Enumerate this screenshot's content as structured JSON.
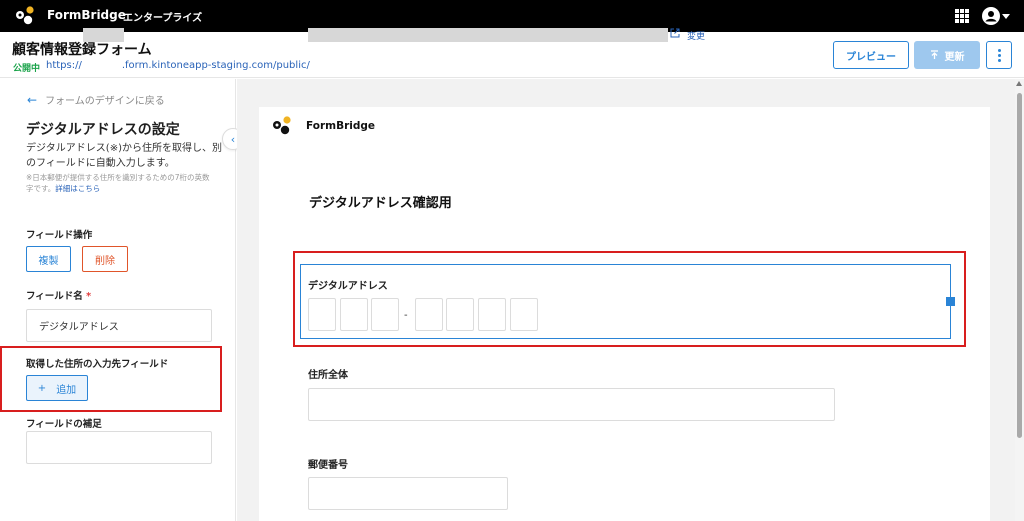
{
  "topbar": {
    "brand": "FormBridge",
    "edition": "エンタープライズ"
  },
  "header": {
    "title": "顧客情報登録フォーム",
    "status": "公開中",
    "url_prefix": "https://",
    "url_middle": ".form.kintoneapp-staging.com/public/",
    "change_label": "変更",
    "preview_label": "プレビュー",
    "update_label": "更新"
  },
  "sidebar": {
    "back_label": "フォームのデザインに戻る",
    "title": "デジタルアドレスの設定",
    "description": "デジタルアドレス(※)から住所を取得し、別のフィールドに自動入力します。",
    "note": "※日本郵便が提供する住所を識別するための7桁の英数字です。",
    "note_link": "詳細はこちら",
    "field_ops_label": "フィールド操作",
    "copy_label": "複製",
    "delete_label": "削除",
    "field_name_label": "フィールド名",
    "required_mark": "*",
    "field_name_value": "デジタルアドレス",
    "target_fields_label": "取得した住所の入力先フィールド",
    "add_label": "追加",
    "add_icon": "+",
    "supplement_label": "フィールドの補足"
  },
  "preview": {
    "brand": "FormBridge",
    "heading": "デジタルアドレス確認用",
    "digital_address_label": "デジタルアドレス",
    "dash": "-",
    "full_address_label": "住所全体",
    "postal_code_label": "郵便番号"
  },
  "colors": {
    "accent": "#2a84d6",
    "danger": "#e0552a",
    "highlight": "#d81e1e",
    "published": "#1aa34a"
  }
}
